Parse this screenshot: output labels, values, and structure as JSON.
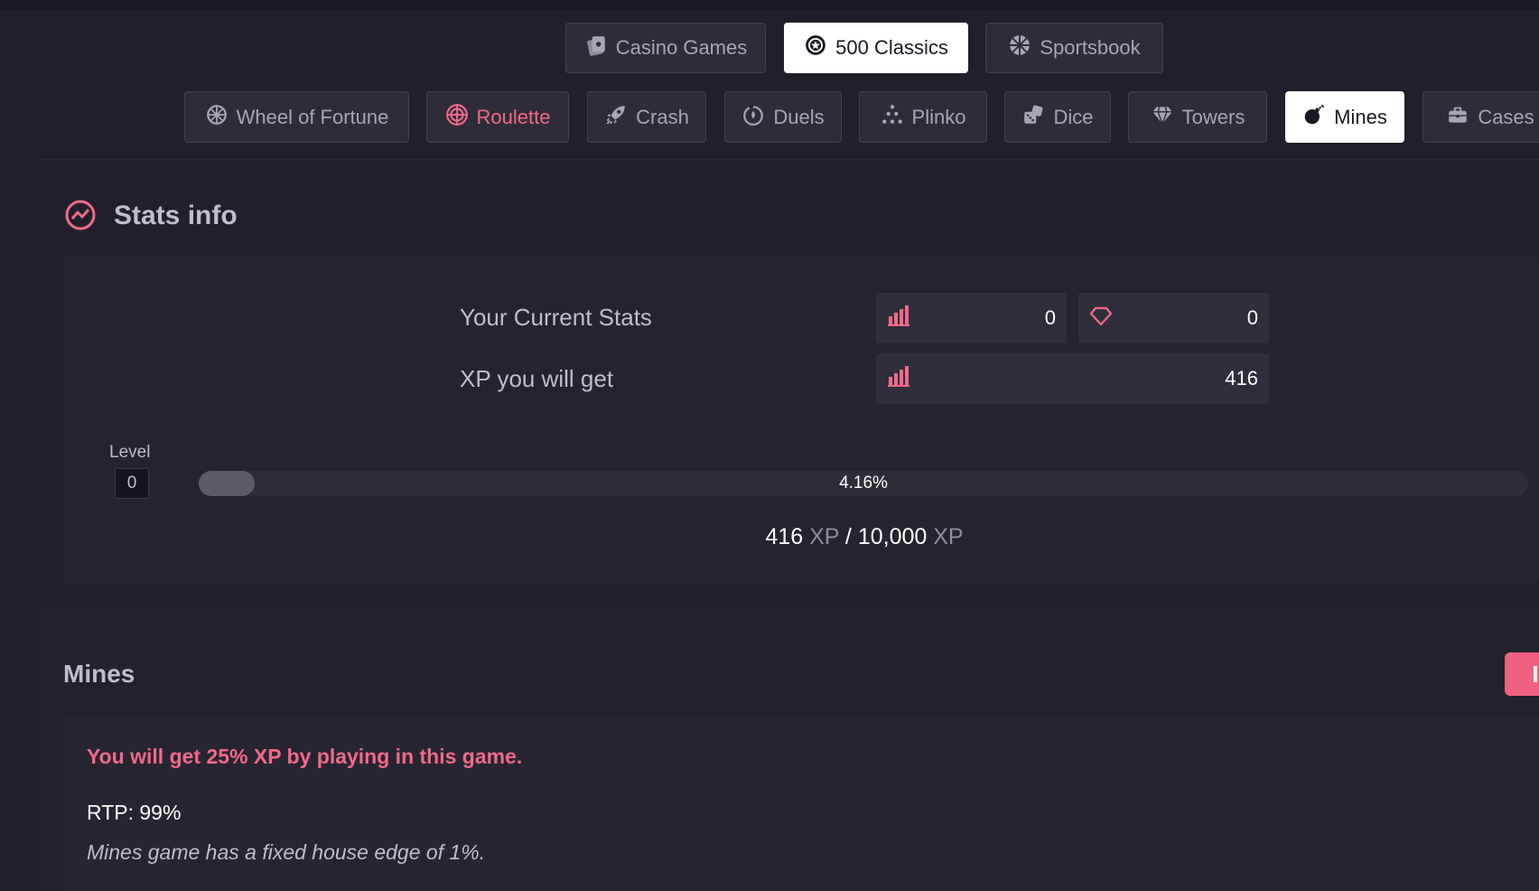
{
  "colors": {
    "accent": "#f06a8a",
    "background": "#211f2b",
    "panel": "#25232f"
  },
  "top_nav": [
    {
      "label": "Casino Games",
      "icon": "cards-icon",
      "active": false
    },
    {
      "label": "500 Classics",
      "icon": "chip-icon",
      "active": true
    },
    {
      "label": "Sportsbook",
      "icon": "ball-icon",
      "active": false
    }
  ],
  "game_nav": [
    {
      "label": "Wheel of Fortune",
      "icon": "wheel-icon",
      "state": "normal"
    },
    {
      "label": "Roulette",
      "icon": "roulette-icon",
      "state": "highlighted"
    },
    {
      "label": "Crash",
      "icon": "rocket-icon",
      "state": "normal"
    },
    {
      "label": "Duels",
      "icon": "duel-icon",
      "state": "normal"
    },
    {
      "label": "Plinko",
      "icon": "plinko-icon",
      "state": "normal"
    },
    {
      "label": "Dice",
      "icon": "dice-icon",
      "state": "normal"
    },
    {
      "label": "Towers",
      "icon": "diamond-icon",
      "state": "normal"
    },
    {
      "label": "Mines",
      "icon": "bomb-icon",
      "state": "active"
    },
    {
      "label": "Cases",
      "icon": "briefcase-icon",
      "state": "normal"
    }
  ],
  "stats": {
    "title": "Stats info",
    "current_label": "Your Current Stats",
    "current_xp": "0",
    "current_gems": "0",
    "will_get_label": "XP you will get",
    "will_get_xp": "416",
    "level_label": "Level",
    "level_value": "0",
    "progress_percent": 4.16,
    "progress_text": "4.16%",
    "xp_current": "416",
    "xp_unit": "XP",
    "xp_separator": "/",
    "xp_target": "10,000"
  },
  "game_info": {
    "title": "Mines",
    "xp_note": "You will get 25% XP by playing in this game.",
    "rtp": "RTP: 99%",
    "house_edge": "Mines game has a fixed house edge of 1%."
  }
}
